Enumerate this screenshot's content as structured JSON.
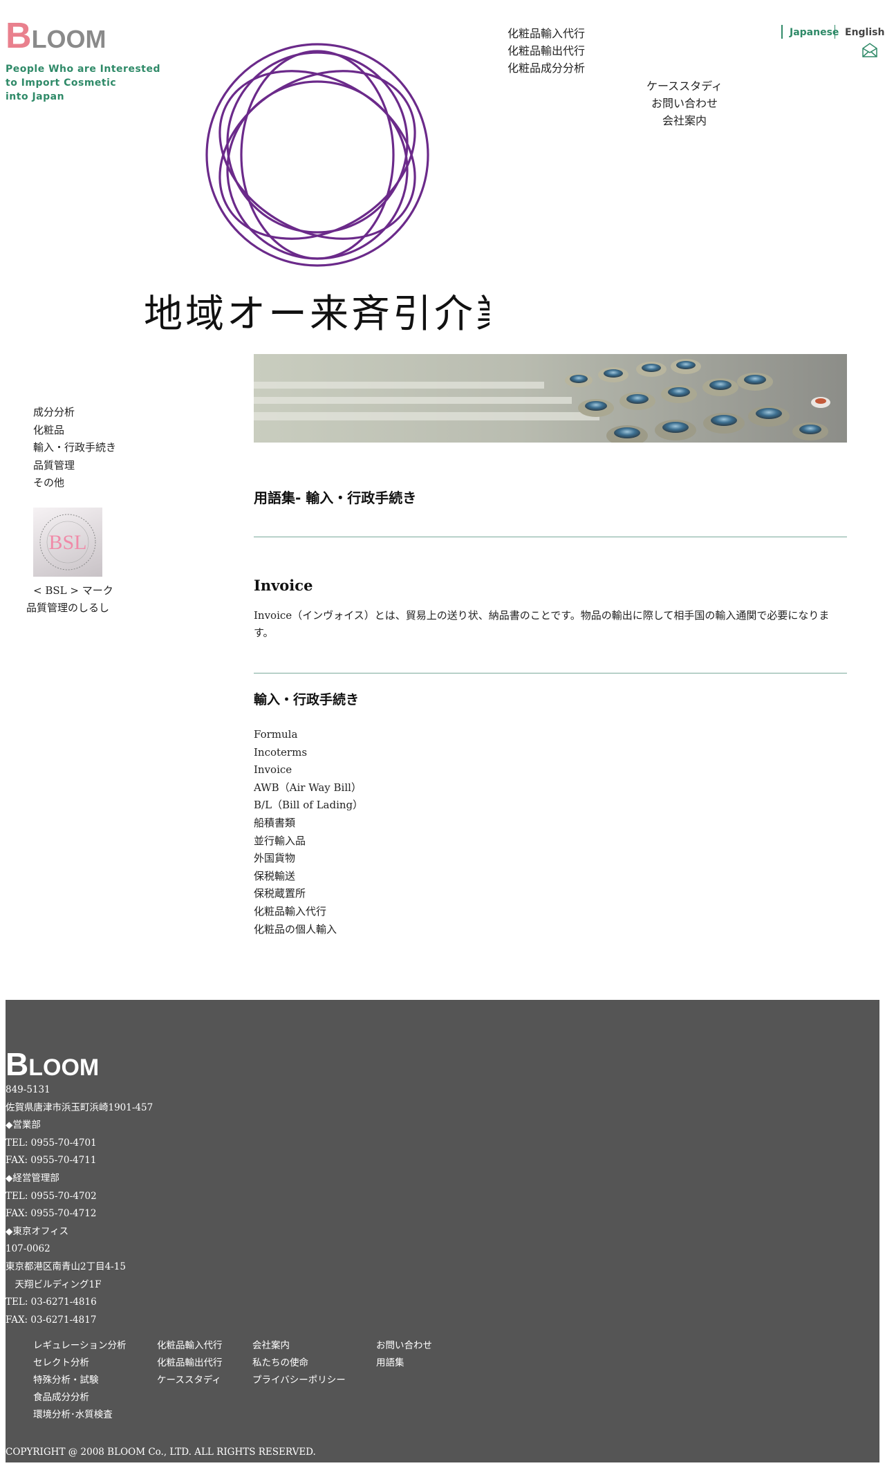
{
  "header": {
    "logo_cap": "B",
    "logo_rest": "LOOM",
    "tagline": [
      "People Who are Interested",
      "to Import Cosmetic",
      "into Japan"
    ],
    "hero_text": "地域オー来斉引介業",
    "nav_primary": [
      "化粧品輸入代行",
      "化粧品輸出代行",
      "化粧品成分分析"
    ],
    "nav_secondary": [
      "ケーススタディ",
      "お問い合わせ",
      "会社案内"
    ],
    "lang_japanese": "Japanese",
    "lang_english": "English",
    "mail_icon": "mail-icon",
    "accent_color": "#2f8a68",
    "logo_accent_color": "#e9808d",
    "emblem_color": "#6b2a8a"
  },
  "sidebar": {
    "items": [
      "成分分析",
      "化粧品",
      "輸入・行政手続き",
      "品質管理",
      "その他"
    ],
    "badge_caption1": "< BSL > マーク",
    "badge_caption2": "品質管理のしるし",
    "badge_text": "BSL"
  },
  "main": {
    "section_title": "用語集- 輸入・行政手続き",
    "term_title": "Invoice",
    "term_body": "Invoice（インヴォイス）とは、貿易上の送り状、納品書のことです。物品の輸出に際して相手国の輸入通関で必要になります。",
    "category_title": "輸入・行政手続き",
    "terms": [
      "Formula",
      "Incoterms",
      "Invoice",
      "AWB（Air Way Bill）",
      "B/L（Bill of Lading）",
      "船積書類",
      "並行輸入品",
      "外国貨物",
      "保税輸送",
      "保税蔵置所",
      "化粧品輸入代行",
      "化粧品の個人輸入"
    ]
  },
  "footer": {
    "logo_cap": "B",
    "logo_rest": "LOOM",
    "address_lines": [
      "849-5131",
      "佐賀県唐津市浜玉町浜崎1901-457",
      "◆営業部",
      "TEL: 0955-70-4701",
      "FAX: 0955-70-4711",
      "◆経営管理部",
      "TEL: 0955-70-4702",
      "FAX: 0955-70-4712",
      "◆東京オフィス",
      "107-0062",
      "東京都港区南青山2丁目4-15",
      "　天翔ビルディング1F",
      "TEL: 03-6271-4816",
      "FAX: 03-6271-4817"
    ],
    "col1": [
      "レギュレーション分析",
      "セレクト分析",
      "特殊分析・試験",
      "食品成分分析",
      "環境分析･水質検査"
    ],
    "col2": [
      "化粧品輸入代行",
      "化粧品輸出代行",
      "ケーススタディ"
    ],
    "col3": [
      "会社案内",
      "私たちの使命",
      "プライバシーポリシー"
    ],
    "col4": [
      "お問い合わせ",
      "用語集"
    ],
    "copyright": "COPYRIGHT @ 2008 BLOOM Co., LTD. ALL RIGHTS RESERVED.",
    "bg_color": "#555555"
  }
}
